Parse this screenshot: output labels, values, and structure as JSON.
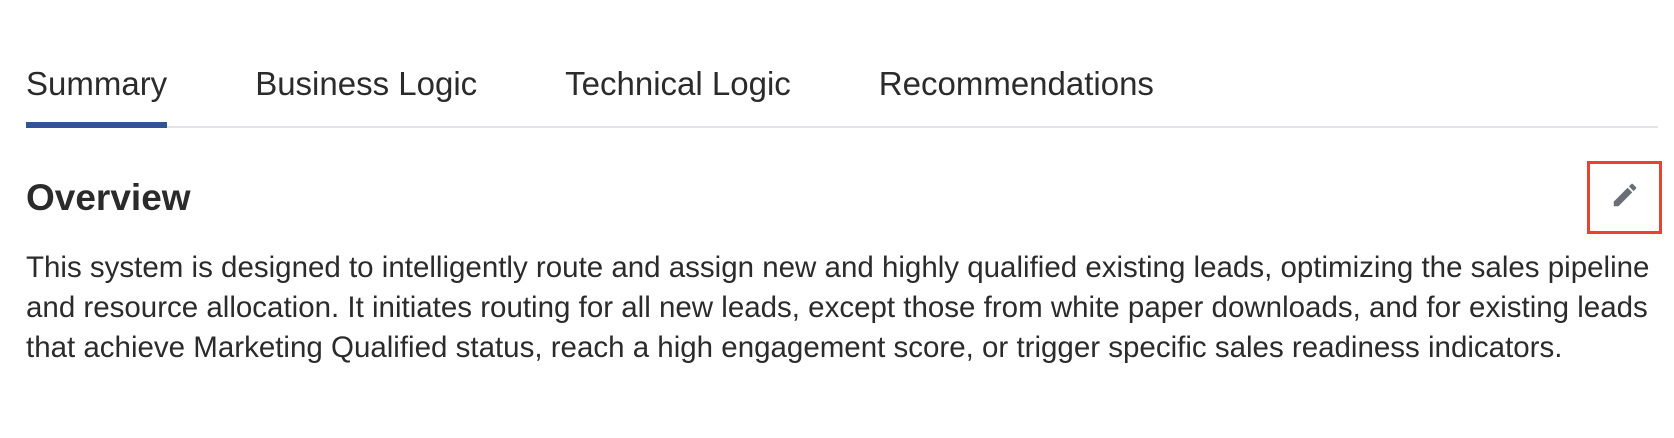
{
  "tabs": [
    {
      "label": "Summary",
      "active": true
    },
    {
      "label": "Business Logic",
      "active": false
    },
    {
      "label": "Technical Logic",
      "active": false
    },
    {
      "label": "Recommendations",
      "active": false
    }
  ],
  "overview": {
    "title": "Overview",
    "body": "This system is designed to intelligently route and assign new and highly qualified existing leads, optimizing the sales pipeline and resource allocation. It initiates routing for all new leads, except those from white paper downloads, and for existing leads that achieve Marketing Qualified status, reach a high engagement score, or trigger specific sales readiness indicators.",
    "edit_icon": "pencil-icon"
  },
  "colors": {
    "active_tab_underline": "#2f5597",
    "highlight_border": "#e8432f",
    "icon": "#6b6f75",
    "text": "#2b2b2b"
  }
}
